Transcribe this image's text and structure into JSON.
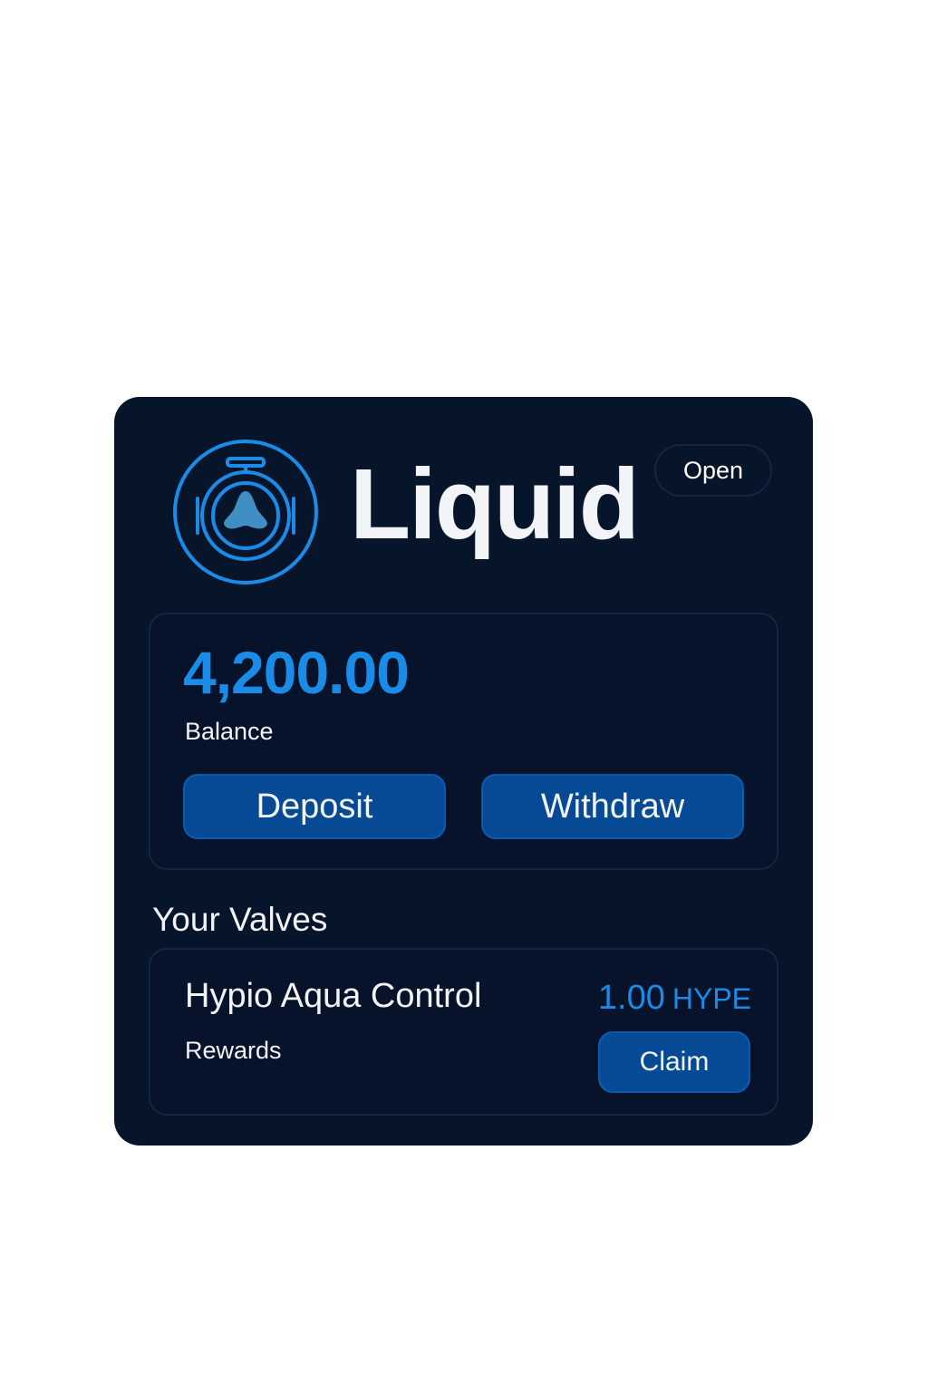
{
  "header": {
    "title": "Liquid",
    "status_button": "Open",
    "logo_icon": "valve-icon"
  },
  "balance": {
    "amount": "4,200.00",
    "label": "Balance",
    "deposit_label": "Deposit",
    "withdraw_label": "Withdraw"
  },
  "valves": {
    "section_title": "Your Valves",
    "items": [
      {
        "name": "Hypio Aqua Control",
        "subtitle": "Rewards",
        "reward_amount": "1.00",
        "reward_unit": "HYPE",
        "claim_label": "Claim"
      }
    ]
  },
  "colors": {
    "background": "#07152b",
    "accent": "#1a8be6",
    "button": "#064a96",
    "text": "#f2f4f7"
  }
}
